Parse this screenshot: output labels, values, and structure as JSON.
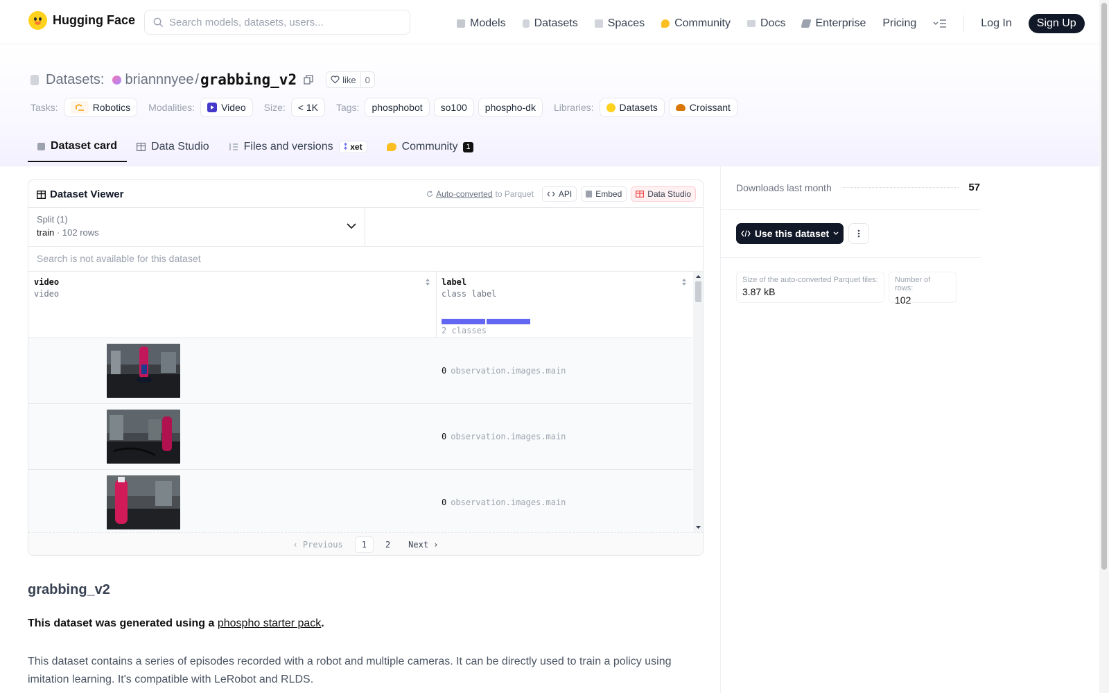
{
  "nav": {
    "brand": "Hugging Face",
    "search_placeholder": "Search models, datasets, users...",
    "items": [
      {
        "label": "Models",
        "icon": "models-icon",
        "color": "#b8bcc4"
      },
      {
        "label": "Datasets",
        "icon": "datasets-icon",
        "color": "#c4c8cf"
      },
      {
        "label": "Spaces",
        "icon": "spaces-icon",
        "color": "#c4c8cf"
      },
      {
        "label": "Community",
        "icon": "community-icon",
        "color": "#fbbf24"
      },
      {
        "label": "Docs",
        "icon": "docs-icon",
        "color": "#c4c8cf"
      },
      {
        "label": "Enterprise",
        "icon": "enterprise-icon",
        "color": "#9ca3af"
      },
      {
        "label": "Pricing"
      }
    ],
    "login": "Log In",
    "signup": "Sign Up"
  },
  "header": {
    "prefix": "Datasets:",
    "owner": "briannnyee",
    "separator": "/",
    "name": "grabbing_v2",
    "like_label": "like",
    "like_count": "0",
    "tasks_label": "Tasks:",
    "task": "Robotics",
    "modalities_label": "Modalities:",
    "modality": "Video",
    "size_label": "Size:",
    "size": "< 1K",
    "tags_label": "Tags:",
    "tags": [
      "phosphobot",
      "so100",
      "phospho-dk"
    ],
    "libraries_label": "Libraries:",
    "libraries": [
      "Datasets",
      "Croissant"
    ]
  },
  "tabs": [
    {
      "label": "Dataset card",
      "active": true
    },
    {
      "label": "Data Studio"
    },
    {
      "label": "Files and versions",
      "badge": "xet"
    },
    {
      "label": "Community",
      "count": "1"
    }
  ],
  "viewer": {
    "title": "Dataset Viewer",
    "auto_converted": "Auto-converted",
    "to_parquet": "to Parquet",
    "api": "API",
    "embed": "Embed",
    "data_studio": "Data Studio",
    "split_label": "Split (1)",
    "split_name": "train",
    "split_dot": "·",
    "split_rows": "102 rows",
    "search_na": "Search is not available for this dataset",
    "columns": [
      {
        "name": "video",
        "type": "video"
      },
      {
        "name": "label",
        "type": "class label",
        "summary": "2 classes"
      }
    ],
    "rows": [
      {
        "label_value": "0",
        "label_name": "observation.images.main"
      },
      {
        "label_value": "0",
        "label_name": "observation.images.main"
      },
      {
        "label_value": "0",
        "label_name": "observation.images.main"
      }
    ],
    "pager": {
      "previous": "Previous",
      "pages": [
        "1",
        "2"
      ],
      "current": "1",
      "next": "Next"
    }
  },
  "sidebar": {
    "downloads_label": "Downloads last month",
    "downloads_value": "57",
    "use_button": "Use this dataset",
    "parquet_size_label": "Size of the auto-converted Parquet files:",
    "parquet_size_value": "3.87 kB",
    "rows_label": "Number of rows:",
    "rows_value": "102"
  },
  "readme": {
    "title": "grabbing_v2",
    "p1_prefix": "This dataset was generated using a ",
    "p1_link": "phospho starter pack",
    "p1_suffix": ".",
    "p2": "This dataset contains a series of episodes recorded with a robot and multiple cameras. It can be directly used to train a policy using imitation learning. It's compatible with LeRobot and RLDS."
  },
  "colors": {
    "accent": "#6366f1",
    "dark": "#111827",
    "hf_yellow": "#ffd21e"
  }
}
